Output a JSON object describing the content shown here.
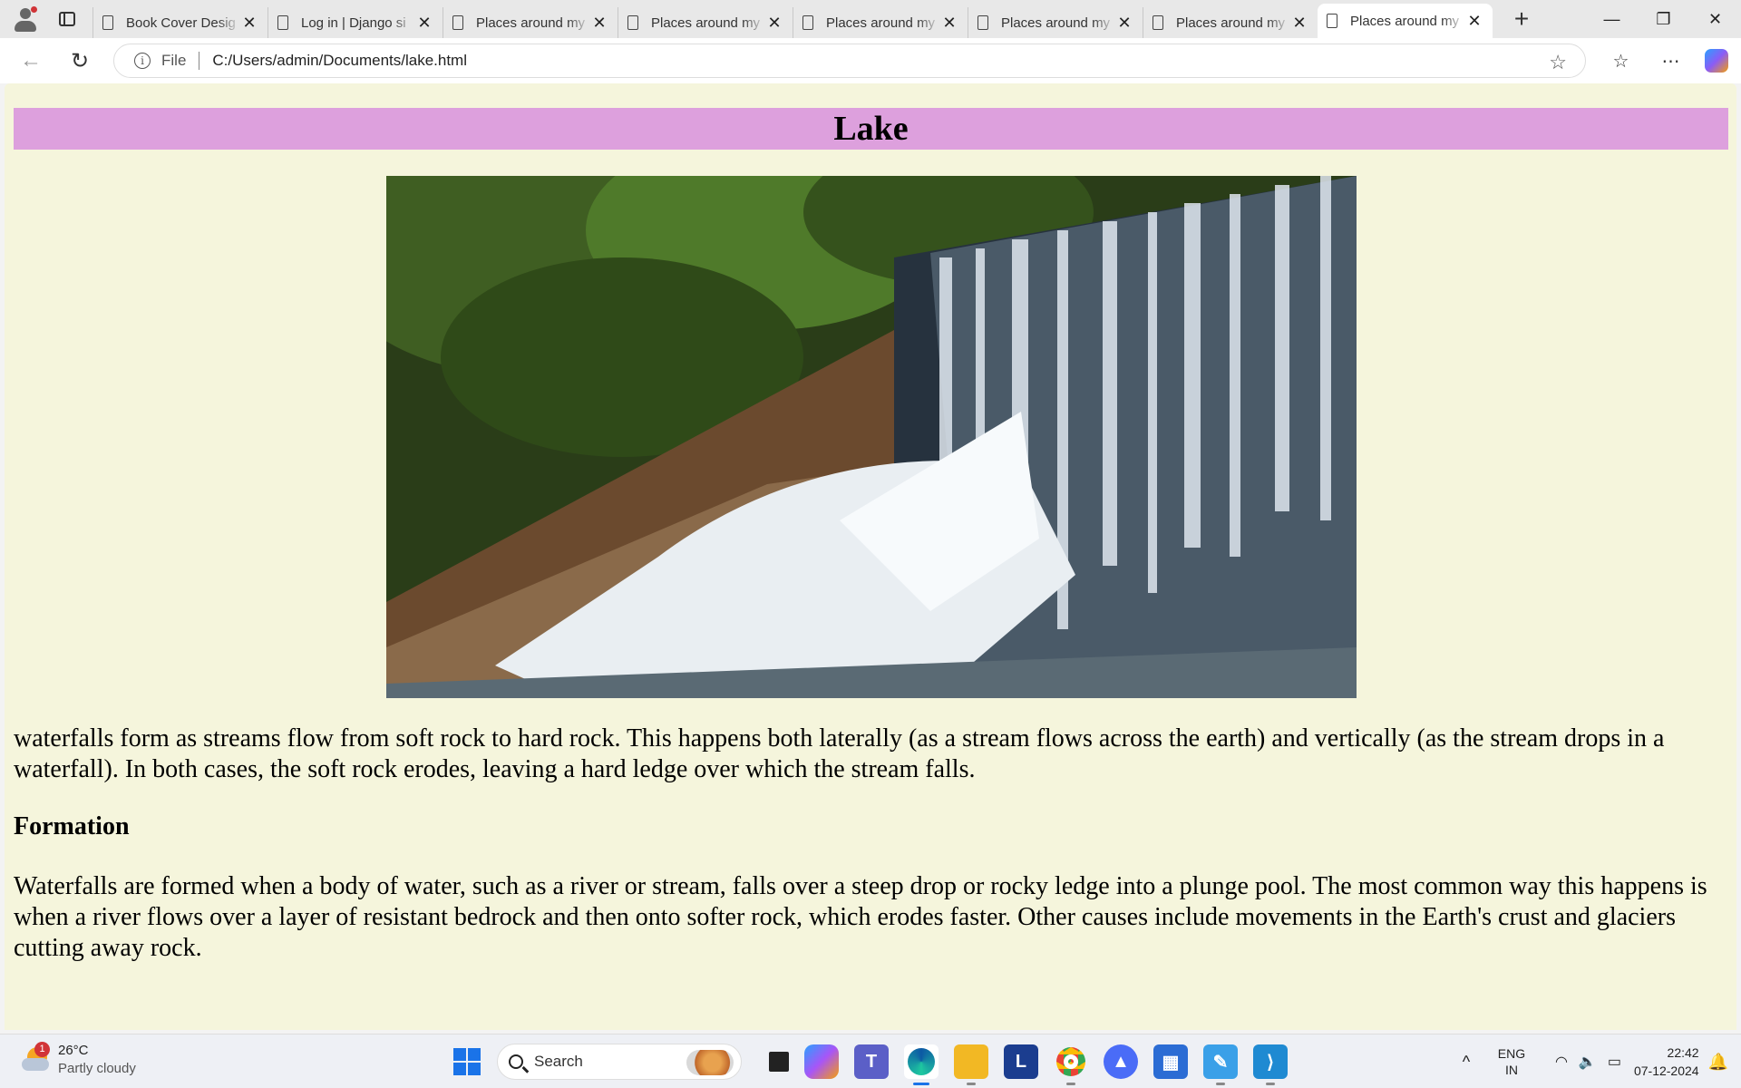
{
  "browser": {
    "tabs": [
      {
        "title": "Book Cover Desig"
      },
      {
        "title": "Log in | Django si"
      },
      {
        "title": "Places around my"
      },
      {
        "title": "Places around my"
      },
      {
        "title": "Places around my"
      },
      {
        "title": "Places around my"
      },
      {
        "title": "Places around my"
      },
      {
        "title": "Places around my",
        "active": true
      }
    ],
    "address": {
      "scheme": "File",
      "url": "C:/Users/admin/Documents/lake.html"
    }
  },
  "page": {
    "heading": "Lake",
    "heading_bg": "#dda0dd",
    "background": "#f5f5dc",
    "image_alt": "waterfall",
    "intro": "waterfalls form as streams flow from soft rock to hard rock. This happens both laterally (as a stream flows across the earth) and vertically (as the stream drops in a waterfall). In both cases, the soft rock erodes, leaving a hard ledge over which the stream falls.",
    "subheading": "Formation",
    "formation": "Waterfalls are formed when a body of water, such as a river or stream, falls over a steep drop or rocky ledge into a plunge pool. The most common way this happens is when a river flows over a layer of resistant bedrock and then onto softer rock, which erodes faster. Other causes include movements in the Earth's crust and glaciers cutting away rock."
  },
  "taskbar": {
    "weather": {
      "temp": "26°C",
      "condition": "Partly cloudy",
      "badge": "1"
    },
    "search_placeholder": "Search",
    "lang": {
      "top": "ENG",
      "bottom": "IN"
    },
    "time": "22:42",
    "date": "07-12-2024",
    "apps": [
      "task-view-icon",
      "copilot-icon",
      "teams-icon",
      "edge-icon",
      "file-explorer-icon",
      "l-app-icon",
      "chrome-icon",
      "app-icon",
      "store-icon",
      "paint-icon",
      "vscode-icon"
    ]
  }
}
